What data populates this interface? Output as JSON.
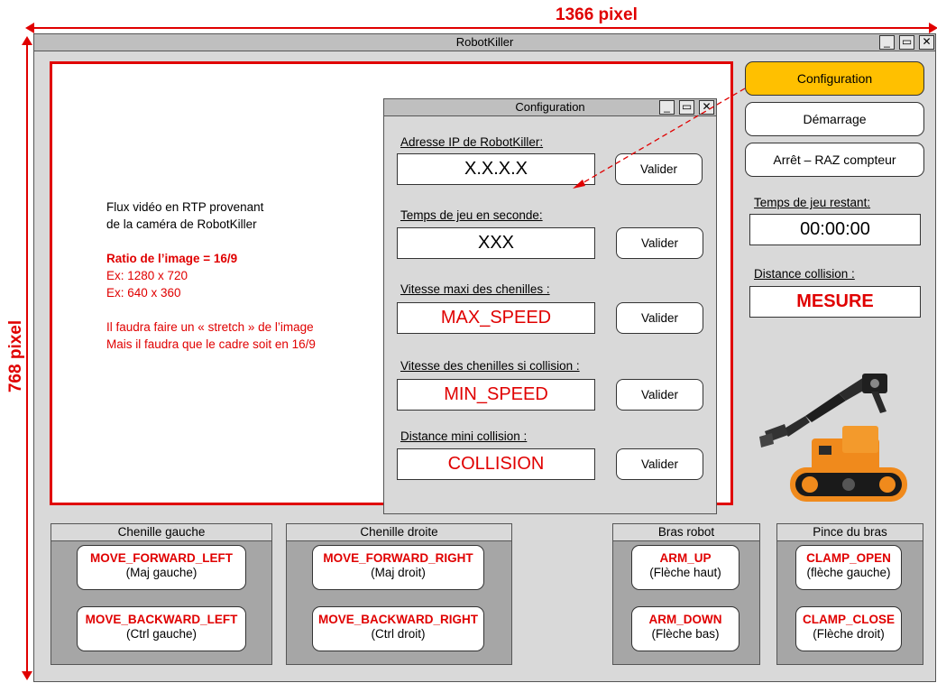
{
  "annotations": {
    "width_label": "1366 pixel",
    "height_label": "768 pixel"
  },
  "window": {
    "title": "RobotKiller"
  },
  "video": {
    "line1": "Flux vidéo en RTP provenant",
    "line2": "de la caméra de RobotKiller",
    "ratio": "Ratio de l’image = 16/9",
    "ex1": "Ex: 1280 x 720",
    "ex2": "Ex: 640 x 360",
    "note1": "Il faudra faire un « stretch » de l’image",
    "note2": "Mais il faudra que le cadre soit en 16/9"
  },
  "config": {
    "title": "Configuration",
    "fields": [
      {
        "label": "Adresse IP de RobotKiller:",
        "value": "X.X.X.X",
        "button": "Valider"
      },
      {
        "label": "Temps de jeu en seconde:",
        "value": "XXX",
        "button": "Valider"
      },
      {
        "label": "Vitesse maxi des chenilles  :",
        "value": "MAX_SPEED",
        "button": "Valider"
      },
      {
        "label": "Vitesse des chenilles si collision :",
        "value": "MIN_SPEED",
        "button": "Valider"
      },
      {
        "label": "Distance mini collision :",
        "value": "COLLISION",
        "button": "Valider"
      }
    ]
  },
  "side": {
    "buttons": [
      "Configuration",
      "Démarrage",
      "Arrêt – RAZ compteur"
    ],
    "time_label": "Temps de jeu restant:",
    "time_value": "00:00:00",
    "distance_label": "Distance collision :",
    "distance_value": "MESURE",
    "accent": "#ffc000"
  },
  "panels": [
    {
      "title": "Chenille gauche",
      "buttons": [
        {
          "cmd": "MOVE_FORWARD_LEFT",
          "key": "(Maj gauche)"
        },
        {
          "cmd": "MOVE_BACKWARD_LEFT",
          "key": "(Ctrl gauche)"
        }
      ]
    },
    {
      "title": "Chenille droite",
      "buttons": [
        {
          "cmd": "MOVE_FORWARD_RIGHT",
          "key": "(Maj droit)"
        },
        {
          "cmd": "MOVE_BACKWARD_RIGHT",
          "key": "(Ctrl droit)"
        }
      ]
    },
    {
      "title": "Bras robot",
      "buttons": [
        {
          "cmd": "ARM_UP",
          "key": "(Flèche haut)"
        },
        {
          "cmd": "ARM_DOWN",
          "key": "(Flèche bas)"
        }
      ]
    },
    {
      "title": "Pince du bras",
      "buttons": [
        {
          "cmd": "CLAMP_OPEN",
          "key": "(flèche gauche)"
        },
        {
          "cmd": "CLAMP_CLOSE",
          "key": "(Flèche droit)"
        }
      ]
    }
  ],
  "colors": {
    "annotation_red": "#e00000",
    "window_bg": "#d9d9d9",
    "panel_bg": "#a6a6a6"
  }
}
